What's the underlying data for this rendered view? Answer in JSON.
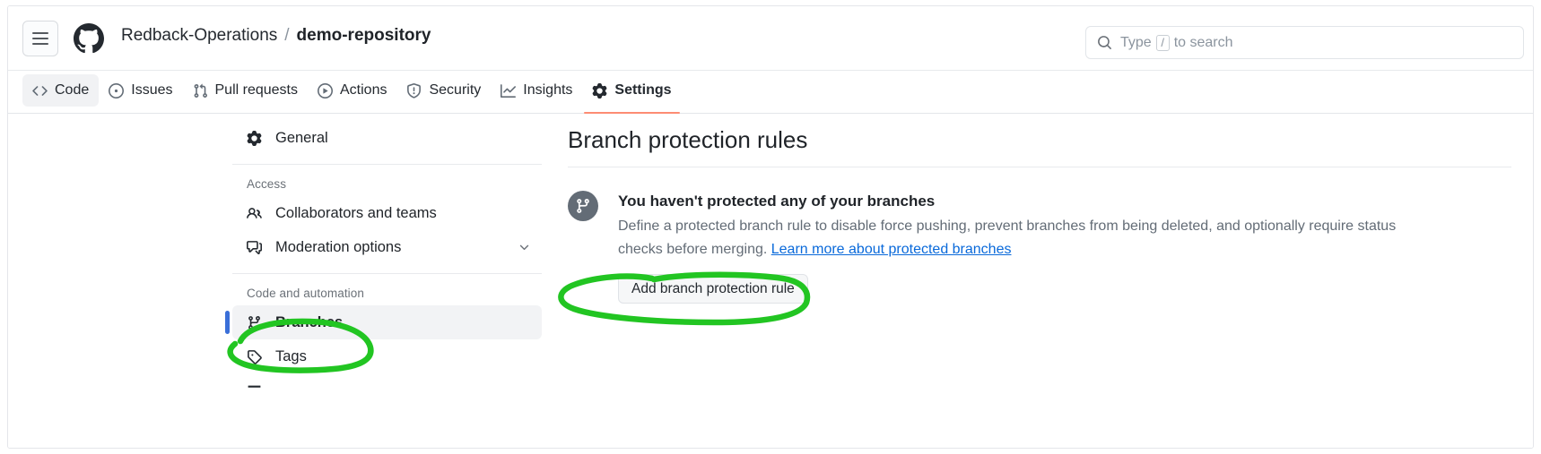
{
  "header": {
    "menu_icon": "hamburger-icon",
    "logo_icon": "github-logo-icon",
    "breadcrumb": {
      "owner": "Redback-Operations",
      "separator": "/",
      "repo": "demo-repository"
    },
    "search": {
      "icon": "search-icon",
      "placeholder_prefix": "Type",
      "kbd": "/",
      "placeholder_suffix": "to search"
    }
  },
  "repo_nav": {
    "tabs": [
      {
        "label": "Code",
        "icon": "code-icon",
        "state": "hovered"
      },
      {
        "label": "Issues",
        "icon": "issue-opened-icon",
        "state": "default"
      },
      {
        "label": "Pull requests",
        "icon": "git-pull-request-icon",
        "state": "default"
      },
      {
        "label": "Actions",
        "icon": "play-icon",
        "state": "default"
      },
      {
        "label": "Security",
        "icon": "shield-icon",
        "state": "default"
      },
      {
        "label": "Insights",
        "icon": "graph-icon",
        "state": "default"
      },
      {
        "label": "Settings",
        "icon": "gear-icon",
        "state": "active"
      }
    ],
    "active_underline_color": "#fd8c73"
  },
  "sidebar": {
    "top_items": [
      {
        "label": "General",
        "icon": "gear-icon"
      }
    ],
    "sections": [
      {
        "title": "Access",
        "items": [
          {
            "label": "Collaborators and teams",
            "icon": "people-icon",
            "chevron": false
          },
          {
            "label": "Moderation options",
            "icon": "comment-discussion-icon",
            "chevron": true
          }
        ]
      },
      {
        "title": "Code and automation",
        "items": [
          {
            "label": "Branches",
            "icon": "git-branch-icon",
            "selected": true
          },
          {
            "label": "Tags",
            "icon": "tag-icon",
            "selected": false
          }
        ]
      }
    ],
    "selected_indicator_color": "#3a6fd8"
  },
  "main": {
    "heading": "Branch protection rules",
    "blankslate": {
      "badge_icon": "git-branch-icon",
      "title": "You haven't protected any of your branches",
      "description_part1": "Define a protected branch rule to disable force pushing, prevent branches from being deleted, and optionally require status checks before merging. ",
      "link_text": "Learn more about protected branches",
      "button_label": "Add branch protection rule"
    }
  },
  "annotations": {
    "color": "#22c522",
    "shapes": [
      {
        "name": "branches-circle",
        "target": "sidebar-item-branches"
      },
      {
        "name": "add-rule-circle",
        "target": "add-branch-protection-rule-button"
      }
    ]
  }
}
